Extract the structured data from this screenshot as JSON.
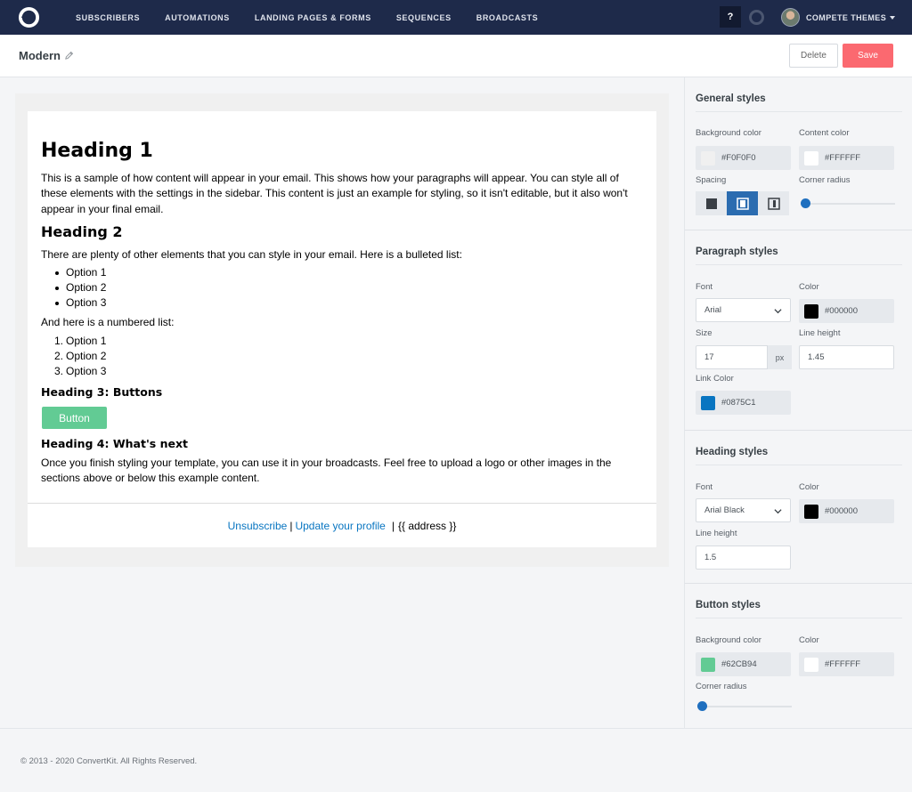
{
  "nav": {
    "links": [
      "SUBSCRIBERS",
      "AUTOMATIONS",
      "LANDING PAGES & FORMS",
      "SEQUENCES",
      "BROADCASTS"
    ],
    "help_label": "?",
    "account_name": "COMPETE THEMES"
  },
  "titlebar": {
    "template_name": "Modern",
    "delete_label": "Delete",
    "save_label": "Save"
  },
  "email": {
    "heading1": "Heading 1",
    "paragraph1_lines": [
      "This is a sample of how content will appear in your email. This shows how your paragraphs will appear. You can style all of",
      "these elements with the settings in the sidebar. This content is just an example for styling, so it isn't editable, but it also won't",
      "appear in your final email."
    ],
    "heading2": "Heading 2",
    "paragraph2": "There are plenty of other elements that you can style in your email. Here is a bulleted list:",
    "bullets": [
      "Option 1",
      "Option 2",
      "Option 3"
    ],
    "paragraph3": "And here is a numbered list:",
    "numbered": [
      "Option 1",
      "Option 2",
      "Option 3"
    ],
    "numbers": [
      "1.",
      "2.",
      "3."
    ],
    "heading3": "Heading 3: Buttons",
    "button_label": "Button",
    "heading4": "Heading 4: What's next",
    "paragraph4_lines": [
      "Once you finish styling your template, you can use it in your broadcasts. Feel free to upload a logo or other images in the",
      "sections above or below this example content."
    ],
    "footer": {
      "unsubscribe": "Unsubscribe",
      "separator1": "|",
      "update_profile": "Update your profile",
      "separator2": "|",
      "address": "{{ address }}"
    }
  },
  "sidebar": {
    "general": {
      "title": "General styles",
      "background_label": "Background color",
      "background_value": "#F0F0F0",
      "content_label": "Content color",
      "content_value": "#FFFFFF",
      "spacing_label": "Spacing",
      "spacing_selected": "medium",
      "corner_radius_label": "Corner radius",
      "corner_radius_level": 0
    },
    "paragraph": {
      "title": "Paragraph styles",
      "font_label": "Font",
      "font_value": "Arial",
      "color_label": "Color",
      "color_value": "#000000",
      "size_label": "Size",
      "size_value": "17",
      "size_unit": "px",
      "line_height_label": "Line height",
      "line_height_value": "1.45",
      "link_color_label": "Link Color",
      "link_color_value": "#0875C1"
    },
    "heading": {
      "title": "Heading styles",
      "font_label": "Font",
      "font_value": "Arial Black",
      "color_label": "Color",
      "color_value": "#000000",
      "line_height_label": "Line height",
      "line_height_value": "1.5"
    },
    "button": {
      "title": "Button styles",
      "background_label": "Background color",
      "background_value": "#62CB94",
      "color_label": "Color",
      "color_value": "#FFFFFF",
      "corner_radius_label": "Corner radius",
      "corner_radius_level": 0
    }
  },
  "footer": {
    "copyright": "© 2013 - 2020 ConvertKit. All Rights Reserved."
  },
  "colors": {
    "nav_bg": "#1E2A4A",
    "save_button": "#FB6970",
    "accent_blue": "#1F6FBF"
  },
  "icons": [
    "convertkit-logo-icon",
    "pencil-icon",
    "chevron-down-icon",
    "spacing-small-icon",
    "spacing-medium-icon",
    "spacing-large-icon"
  ]
}
